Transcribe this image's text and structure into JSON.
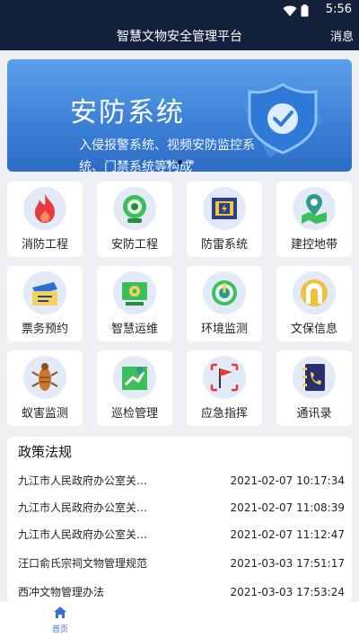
{
  "status_bar": {
    "time": "5:56",
    "wifi_icon": "wifi-icon",
    "battery_icon": "battery-icon"
  },
  "header": {
    "title": "智慧文物安全管理平台",
    "message_label": "消息"
  },
  "banner": {
    "title": "安防系统",
    "subtitle": "入侵报警系统、视频安防监控系统、门禁系统等构成",
    "pages": 3,
    "active_page": 2
  },
  "colors": {
    "header_bg": "#14213d",
    "accent": "#3a6fd6",
    "background": "#eef0f4"
  },
  "grid": {
    "items": [
      {
        "label": "消防工程",
        "icon": "fire-icon"
      },
      {
        "label": "安防工程",
        "icon": "camera-icon"
      },
      {
        "label": "防雷系统",
        "icon": "lightning-box-icon"
      },
      {
        "label": "建控地带",
        "icon": "map-pin-icon"
      },
      {
        "label": "票务预约",
        "icon": "ticket-icon"
      },
      {
        "label": "智慧运维",
        "icon": "gear-monitor-icon"
      },
      {
        "label": "环境监测",
        "icon": "gauge-icon"
      },
      {
        "label": "文保信息",
        "icon": "arch-icon"
      },
      {
        "label": "蚁害监测",
        "icon": "termite-icon"
      },
      {
        "label": "巡检管理",
        "icon": "map-route-icon"
      },
      {
        "label": "应急指挥",
        "icon": "flag-icon"
      },
      {
        "label": "通讯录",
        "icon": "phone-book-icon"
      }
    ]
  },
  "policy": {
    "title": "政策法规",
    "rows": [
      {
        "title": "九江市人民政府办公室关…",
        "date": "2021-02-07 10:17:34"
      },
      {
        "title": "九江市人民政府办公室关…",
        "date": "2021-02-07 11:08:39"
      },
      {
        "title": "九江市人民政府办公室关…",
        "date": "2021-02-07 11:12:47"
      },
      {
        "title": "汪口俞氏宗祠文物管理规范",
        "date": "2021-03-03 17:51:17"
      },
      {
        "title": "西冲文物管理办法",
        "date": "2021-03-03 17:53:24"
      }
    ]
  },
  "tabbar": {
    "home_label": "首页",
    "home_icon": "home-icon"
  }
}
